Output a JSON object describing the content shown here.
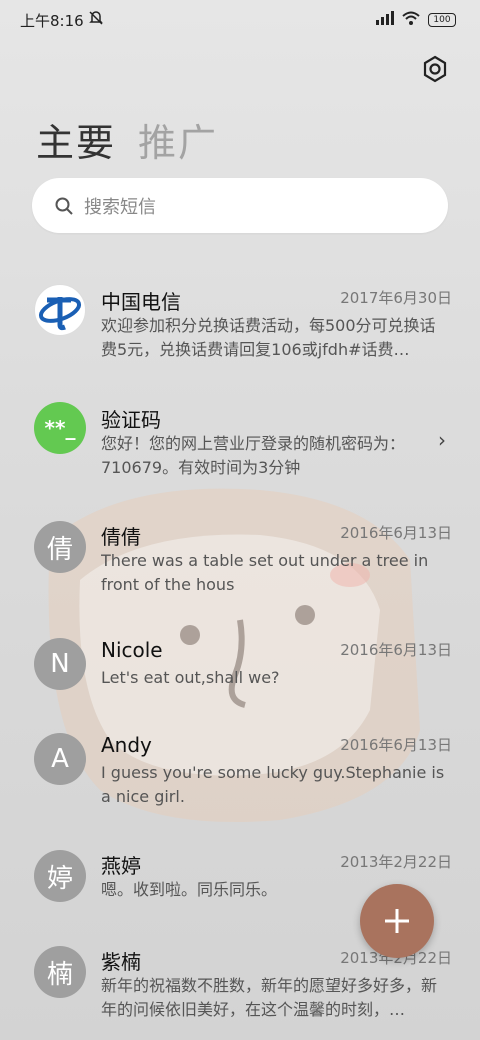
{
  "status": {
    "time": "上午8:16",
    "battery": "100"
  },
  "tabs": {
    "main": "主要",
    "promo": "推广"
  },
  "search": {
    "placeholder": "搜索短信"
  },
  "conversations": [
    {
      "name": "中国电信",
      "date": "2017年6月30日",
      "preview": "欢迎参加积分兑换话费活动，每500分可兑换话费5元，兑换话费请回复106或jfdh#话费…",
      "avatar": "telecom-logo"
    },
    {
      "name": "验证码",
      "date": "",
      "preview": "您好！您的网上营业厅登录的随机密码为：710679。有效时间为3分钟",
      "avatar_text": "**_"
    },
    {
      "name": "倩倩",
      "date": "2016年6月13日",
      "preview": "There was a table set out under a tree in front of the hous",
      "avatar_text": "倩"
    },
    {
      "name": "Nicole",
      "date": "2016年6月13日",
      "preview": "Let's eat out,shall we?",
      "avatar_text": "N"
    },
    {
      "name": "Andy",
      "date": "2016年6月13日",
      "preview": "I guess you're some lucky guy.Stephanie is a nice girl.",
      "avatar_text": "A"
    },
    {
      "name": "燕婷",
      "date": "2013年2月22日",
      "preview": "嗯。收到啦。同乐同乐。",
      "avatar_text": "婷"
    },
    {
      "name": "紫楠",
      "date": "2013年2月22日",
      "preview": "新年的祝福数不胜数，新年的愿望好多好多，新年的问候依旧美好，在这个温馨的时刻，…",
      "avatar_text": "楠"
    }
  ],
  "colors": {
    "fab": "#a9735e",
    "green_avatar": "#63c951",
    "gray_avatar": "#9f9f9f"
  }
}
